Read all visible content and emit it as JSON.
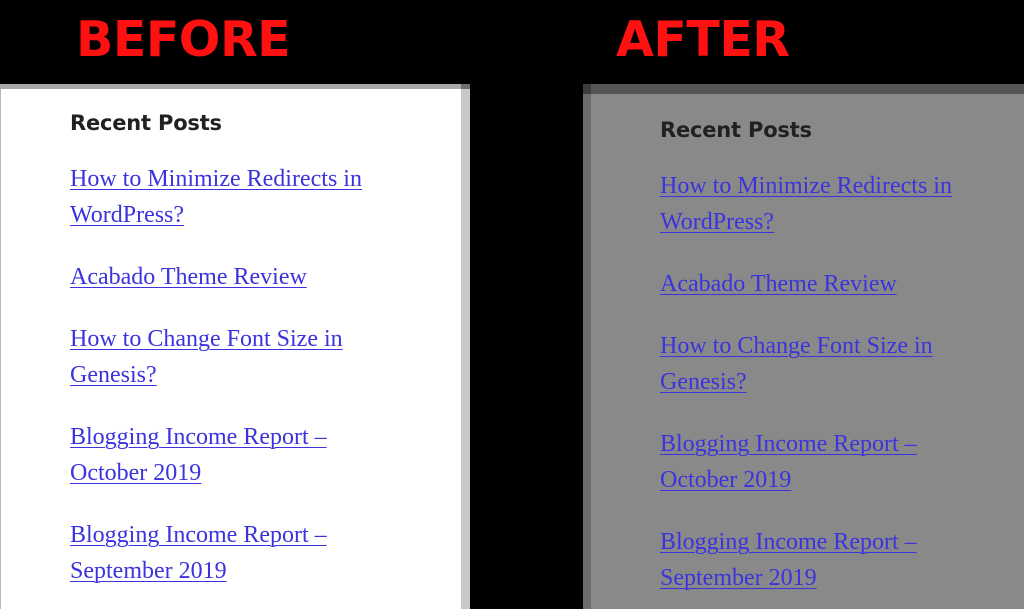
{
  "labels": {
    "before": "BEFORE",
    "after": "AFTER"
  },
  "colors": {
    "background": "#000000",
    "label_text": "#ff1111",
    "before_panel_background": "#ffffff",
    "after_panel_background": "#898989",
    "link": "#3b33dd",
    "heading": "#212121"
  },
  "widget": {
    "title": "Recent Posts",
    "posts": [
      "How to Minimize Redirects in WordPress?",
      "Acabado Theme Review",
      "How to Change Font Size in Genesis?",
      "Blogging Income Report – October 2019",
      "Blogging Income Report – September 2019"
    ]
  },
  "panels": [
    {
      "label": "BEFORE",
      "title": "Recent Posts",
      "posts": [
        "How to Minimize Redirects in WordPress?",
        "Acabado Theme Review",
        "How to Change Font Size in Genesis?",
        "Blogging Income Report – October 2019",
        "Blogging Income Report – September 2019"
      ]
    },
    {
      "label": "AFTER",
      "title": "Recent Posts",
      "posts": [
        "How to Minimize Redirects in WordPress?",
        "Acabado Theme Review",
        "How to Change Font Size in Genesis?",
        "Blogging Income Report – October 2019",
        "Blogging Income Report – September 2019"
      ]
    }
  ]
}
